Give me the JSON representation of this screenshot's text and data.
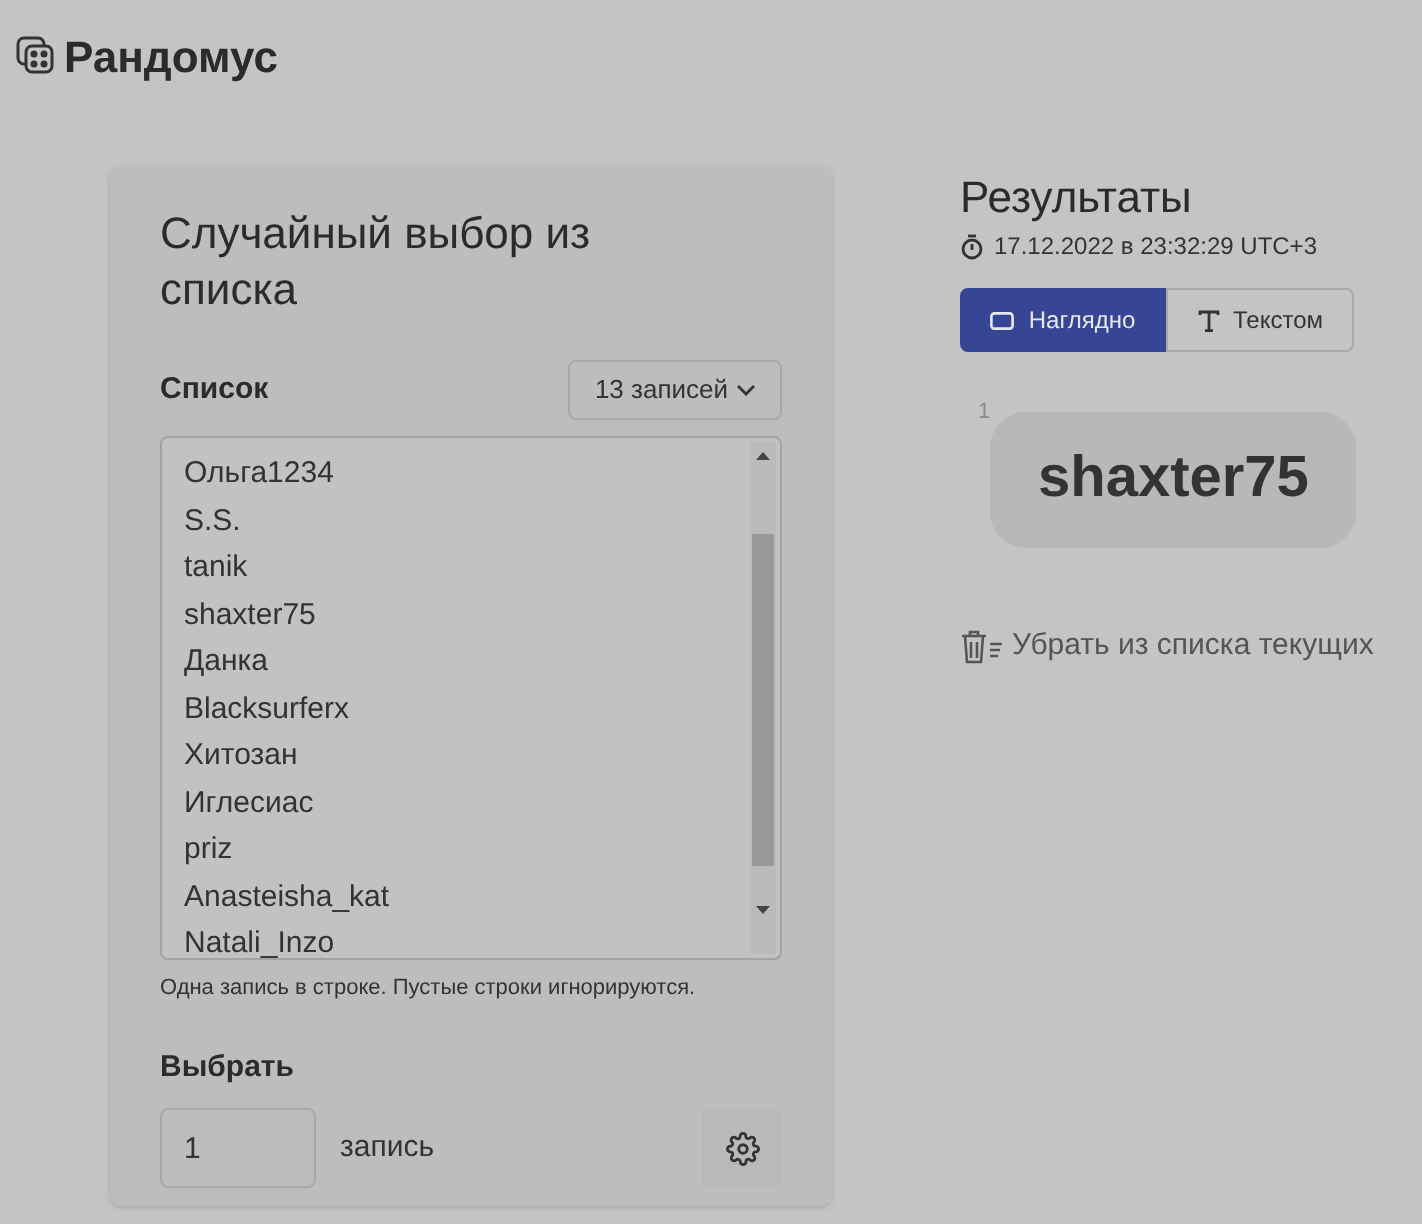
{
  "app": {
    "title": "Рандомус"
  },
  "form": {
    "heading": "Случайный выбор из списка",
    "list_label": "Список",
    "count_button": "13 записей",
    "entries": [
      "Ольга1234",
      "S.S.",
      "tanik",
      "shaxter75",
      "Данка",
      "Blacksurferx",
      "Хитозан",
      "Иглесиас",
      "priz",
      "Anasteisha_kat",
      "Natali_Inzo"
    ],
    "hint": "Одна запись в строке. Пустые строки игнорируются.",
    "pick_label": "Выбрать",
    "pick_value": "1",
    "pick_unit": "запись"
  },
  "results": {
    "heading": "Результаты",
    "timestamp": "17.12.2022 в 23:32:29 UTC+3",
    "tabs": [
      {
        "label": "Наглядно",
        "kind": "visual",
        "selected": true
      },
      {
        "label": "Текстом",
        "kind": "text",
        "selected": false
      }
    ],
    "winners": [
      {
        "index": "1",
        "name": "shaxter75"
      }
    ],
    "remove_link": "Убрать из списка текущих"
  }
}
